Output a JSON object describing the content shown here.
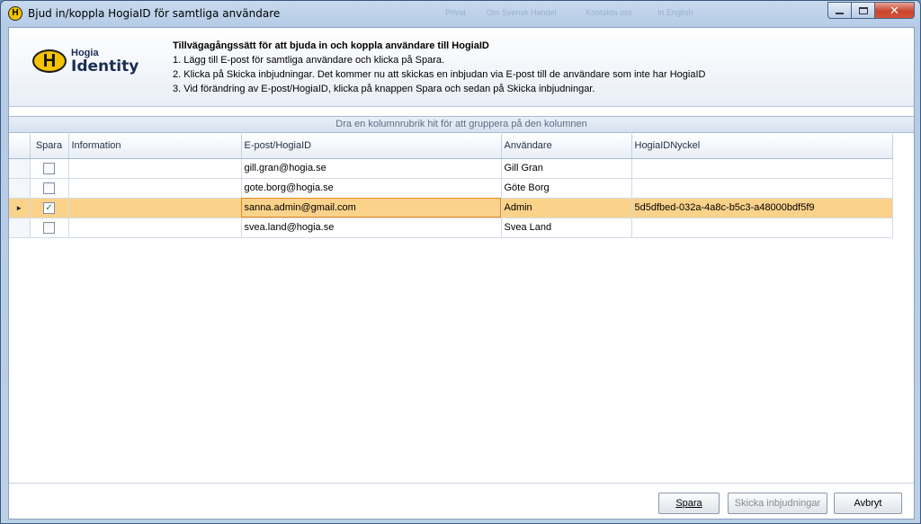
{
  "window": {
    "title": "Bjud in/koppla HogiaID för samtliga användare",
    "icon_letter": "H",
    "icon": "hogia-h-icon",
    "background_labels": [
      "Privat",
      "Om Svensk Handel",
      "Kontakta oss",
      "In English"
    ]
  },
  "logo": {
    "letter": "H",
    "line1": "Hogia",
    "line2": "Identity"
  },
  "instructions": {
    "title": "Tillvägagångssätt för att bjuda in och koppla användare till HogiaID",
    "steps": [
      "1. Lägg till E-post för samtliga användare och klicka på Spara.",
      "2. Klicka på Skicka inbjudningar. Det kommer nu att skickas en inbjudan via E-post till de användare som inte har HogiaID",
      "3. Vid förändring av E-post/HogiaID, klicka på knappen Spara och sedan på Skicka inbjudningar."
    ]
  },
  "grid": {
    "group_hint": "Dra en kolumnrubrik hit för att gruppera på den kolumnen",
    "columns": [
      "Spara",
      "Information",
      "E-post/HogiaID",
      "Användare",
      "HogiaIDNyckel"
    ],
    "rows": [
      {
        "spara": false,
        "information": "",
        "email": "gill.gran@hogia.se",
        "user": "Gill Gran",
        "key": ""
      },
      {
        "spara": false,
        "information": "",
        "email": "gote.borg@hogia.se",
        "user": "Göte Borg",
        "key": ""
      },
      {
        "spara": true,
        "information": "",
        "email": "sanna.admin@gmail.com",
        "user": "Admin",
        "key": "5d5dfbed-032a-4a8c-b5c3-a48000bdf5f9",
        "selected": true
      },
      {
        "spara": false,
        "information": "",
        "email": "svea.land@hogia.se",
        "user": "Svea Land",
        "key": ""
      }
    ]
  },
  "buttons": {
    "save": "Spara",
    "send": "Skicka inbjudningar",
    "cancel": "Avbryt"
  },
  "colors": {
    "selected_row": "#fbd28a",
    "focus_border": "#e58a1f",
    "close_button": "#c9452c"
  }
}
